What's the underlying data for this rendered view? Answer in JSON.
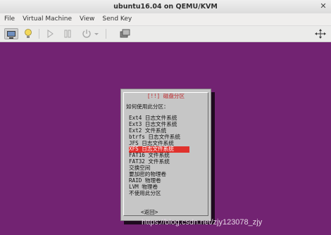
{
  "window": {
    "title": "ubuntu16.04 on QEMU/KVM",
    "close": "✕"
  },
  "menu": {
    "items": [
      "File",
      "Virtual Machine",
      "View",
      "Send Key"
    ]
  },
  "toolbar": {
    "icons": [
      "console-icon",
      "bulb-icon",
      "play-icon",
      "pause-icon",
      "power-icon",
      "power-menu-icon",
      "snapshot-icon",
      "fullscreen-icon"
    ]
  },
  "dialog": {
    "title": "[!!] 磁盘分区",
    "prompt": "如何使用此分区：",
    "options": [
      "Ext4 日志文件系统",
      "Ext3 日志文件系统",
      "Ext2 文件系统",
      "btrfs 日志文件系统",
      "JFS 日志文件系统",
      "XFS 日志文件系统",
      "FAT16 文件系统",
      "FAT32 文件系统",
      "交换空间",
      "要加密的物理卷",
      "RAID 物理卷",
      "LVM 物理卷",
      "不使用此分区"
    ],
    "selected_option": "XFS 日志文件系统",
    "back_label": "<返回>"
  },
  "watermark": "https://blog.csdn.net/zjy123078_zjy",
  "colors": {
    "desktop": "#722372",
    "highlight": "#e0322d",
    "dialog_bg": "#c6c6c6",
    "title_red": "#c0262a"
  }
}
